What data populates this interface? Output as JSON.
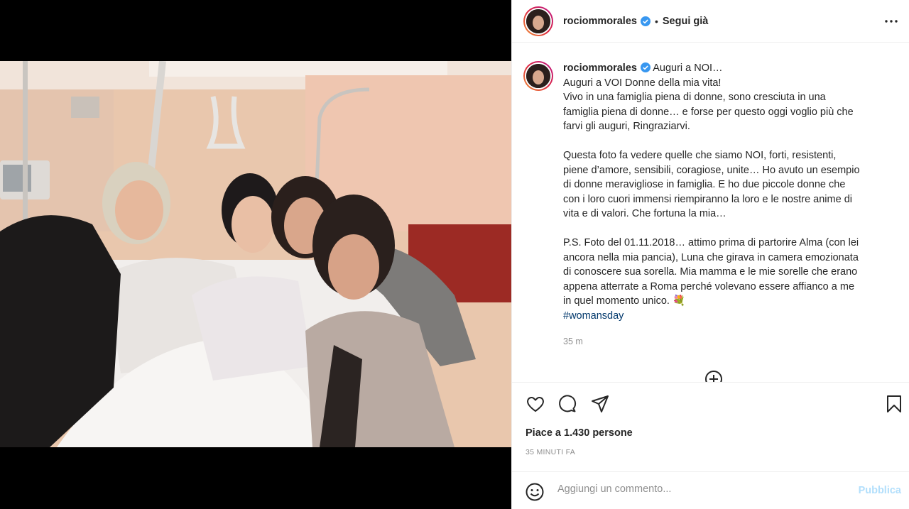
{
  "post": {
    "username": "rociommorales",
    "follow_label": "Segui già",
    "dot": "•"
  },
  "caption": {
    "username": "rociommorales",
    "first_line": "Auguri a NOI…",
    "lines_p1": [
      "Auguri a VOI Donne della mia vita!",
      "Vivo in una famiglia piena di donne, sono cresciuta in una",
      "famiglia piena di donne… e forse per questo oggi voglio più che",
      "farvi gli auguri, Ringraziarvi."
    ],
    "lines_p2": [
      "Questa foto fa vedere quelle che siamo NOI, forti, resistenti,",
      "piene d’amore, sensibili, coragiose, unite… Ho avuto un esempio",
      "di donne meravigliose in famiglia. E ho due piccole donne che",
      "con i loro cuori immensi riempiranno la loro e le nostre anime di",
      "vita e di valori. Che fortuna la mia…"
    ],
    "lines_p3": [
      "P.S. Foto del 01.11.2018… attimo prima di partorire Alma (con lei",
      "ancora nella mia pancia), Luna che girava in camera emozionata",
      "di conoscere sua sorella. Mia mamma e le mie sorelle che erano",
      "appena atterrate a Roma perché volevano essere affianco a me",
      "in quel momento unico. 💐"
    ],
    "hashtag": "#womansday",
    "time": "35 m"
  },
  "actions": {
    "likes_text": "Piace a 1.430 persone",
    "ago_text": "35 MINUTI FA"
  },
  "comment": {
    "placeholder": "Aggiungi un commento...",
    "publish_label": "Pubblica"
  },
  "colors": {
    "verified": "#3897f0",
    "publish_disabled": "#b2dffc",
    "hashtag": "#00376b",
    "muted": "#8e8e8e"
  },
  "icons": {
    "like": "heart-icon",
    "comment": "comment-icon",
    "share": "paper-plane-icon",
    "save": "bookmark-icon",
    "more": "more-options-icon",
    "emoji": "emoji-icon",
    "load_more": "plus-circle-icon"
  }
}
